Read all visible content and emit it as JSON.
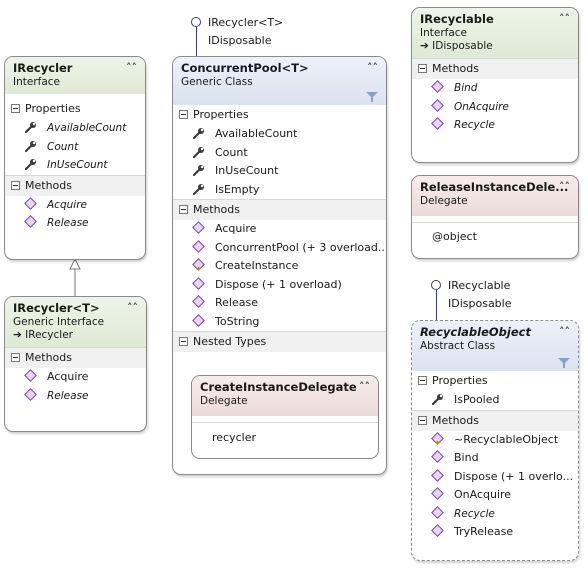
{
  "colors": {
    "header_green": "#dfe9d4",
    "header_blue": "#dbe2f0",
    "header_pink": "#ecdada",
    "method_icon": "#7a3fa8",
    "lollipop": "#3a3a8a"
  },
  "irecycler": {
    "title": "IRecycler",
    "kind": "Interface",
    "properties_label": "Properties",
    "properties": [
      "AvailableCount",
      "Count",
      "InUseCount"
    ],
    "methods_label": "Methods",
    "methods": [
      "Acquire",
      "Release"
    ]
  },
  "irecycler_t": {
    "title": "IRecycler<T>",
    "kind": "Generic Interface",
    "base": "IRecycler",
    "methods_label": "Methods",
    "methods": [
      "Acquire",
      "Release"
    ]
  },
  "concurrent_pool": {
    "lollipop": [
      "IRecycler<T>",
      "IDisposable"
    ],
    "title": "ConcurrentPool<T>",
    "kind": "Generic Class",
    "properties_label": "Properties",
    "properties": [
      "AvailableCount",
      "Count",
      "InUseCount",
      "IsEmpty"
    ],
    "methods_label": "Methods",
    "methods": [
      "Acquire",
      "ConcurrentPool (+ 3 overload...",
      "CreateInstance",
      "Dispose (+ 1 overload)",
      "Release",
      "ToString"
    ],
    "nested_label": "Nested Types",
    "nested": {
      "title": "CreateInstanceDelegate",
      "kind": "Delegate",
      "param": "recycler"
    }
  },
  "irecyclable": {
    "title": "IRecyclable",
    "kind": "Interface",
    "base": "IDisposable",
    "methods_label": "Methods",
    "methods": [
      "Bind",
      "OnAcquire",
      "Recycle"
    ]
  },
  "release_delegate": {
    "title": "ReleaseInstanceDele...",
    "kind": "Delegate",
    "param": "@object"
  },
  "recyclable_object": {
    "lollipop": [
      "IRecyclable",
      "IDisposable"
    ],
    "title": "RecyclableObject",
    "kind": "Abstract Class",
    "properties_label": "Properties",
    "properties": [
      "IsPooled"
    ],
    "methods_label": "Methods",
    "methods": [
      "~RecyclableObject",
      "Bind",
      "Dispose (+ 1 overlo...",
      "OnAcquire",
      "Recycle",
      "TryRelease"
    ]
  }
}
